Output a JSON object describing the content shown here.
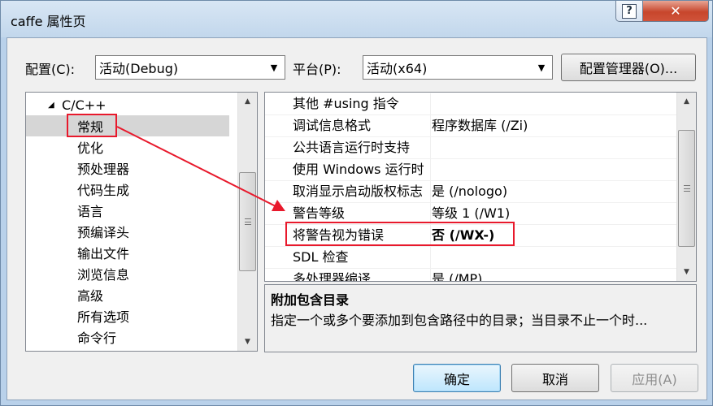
{
  "window": {
    "title": "caffe 属性页",
    "help_glyph": "?",
    "close_glyph": "✕"
  },
  "config": {
    "label": "配置(C):",
    "value": "活动(Debug)"
  },
  "platform": {
    "label": "平台(P):",
    "value": "活动(x64)"
  },
  "config_manager_label": "配置管理器(O)...",
  "tree": {
    "parent": {
      "expander": "◢",
      "label": "C/C++"
    },
    "items": [
      {
        "label": "常规",
        "selected": true
      },
      {
        "label": "优化"
      },
      {
        "label": "预处理器"
      },
      {
        "label": "代码生成"
      },
      {
        "label": "语言"
      },
      {
        "label": "预编译头"
      },
      {
        "label": "输出文件"
      },
      {
        "label": "浏览信息"
      },
      {
        "label": "高级"
      },
      {
        "label": "所有选项"
      },
      {
        "label": "命令行"
      }
    ]
  },
  "properties": [
    {
      "name": "其他 #using 指令",
      "value": ""
    },
    {
      "name": "调试信息格式",
      "value": "程序数据库 (/Zi)"
    },
    {
      "name": "公共语言运行时支持",
      "value": ""
    },
    {
      "name": "使用 Windows 运行时",
      "value": ""
    },
    {
      "name": "取消显示启动版权标志",
      "value": "是 (/nologo)"
    },
    {
      "name": "警告等级",
      "value": "等级 1 (/W1)"
    },
    {
      "name": "将警告视为错误",
      "value": "否 (/WX-)",
      "bold": true
    },
    {
      "name": "SDL 检查",
      "value": ""
    },
    {
      "name": "多处理器编译",
      "value": "是 (/MP)"
    }
  ],
  "description": {
    "title": "附加包含目录",
    "text": "指定一个或多个要添加到包含路径中的目录；当目录不止一个时..."
  },
  "buttons": {
    "ok": "确定",
    "cancel": "取消",
    "apply": "应用(A)"
  },
  "annotation_color": "#e8192c"
}
